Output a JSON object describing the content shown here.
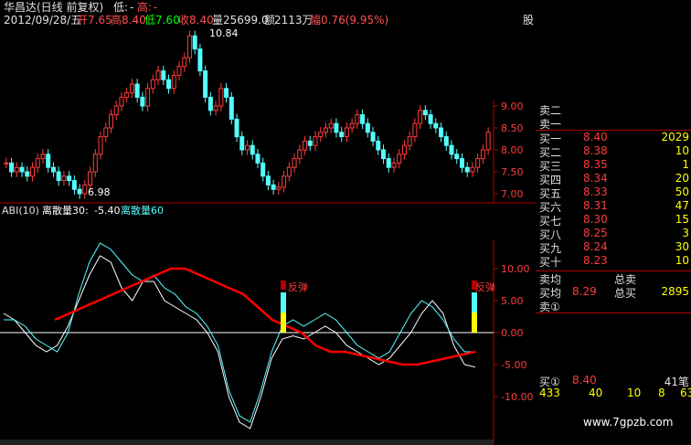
{
  "header": {
    "stock": "华昌达(日线 前复权)",
    "low_label": "低:",
    "low_value": "-",
    "high_label": "高:",
    "high_value": "-",
    "date": "2012/09/28/五",
    "open_label": "开",
    "open_value": "7.65",
    "high2_label": "高",
    "high2_value": "8.40",
    "low2_label": "低",
    "low2_value": "7.60",
    "close_label": "收",
    "close_value": "8.40",
    "vol_label": "量",
    "vol_value": "25699.0",
    "amt_label": "额",
    "amt_value": "2113万",
    "chg_label": "幅",
    "chg_value": "0.76(9.95%)",
    "cut": "股"
  },
  "indicator": {
    "name": "ABI(10)",
    "line1_label": "离散量30:",
    "line1_value": "-5.40",
    "line2_label": "离散量60",
    "signal_text": "反弹"
  },
  "watermark": "www.7gpzb.com",
  "colors": {
    "up": "#ff3c3c",
    "down": "#54ffff",
    "axis": "#b00000",
    "white": "#ffffff",
    "yellow": "#ffff00",
    "green": "#00ff00",
    "ma": "#ff0000"
  },
  "chart_data": [
    {
      "type": "candlestick",
      "title": "",
      "ylim": [
        6.8,
        10.9
      ],
      "y_ticks": [
        "9.00",
        "8.50",
        "8.00",
        "7.50",
        "7.00"
      ],
      "annotations": [
        "10.84",
        "6.98"
      ],
      "high": 10.84,
      "low": 6.98,
      "bar_count": 120
    },
    {
      "type": "line",
      "title": "ABI(10)",
      "ylim": [
        -12,
        12
      ],
      "y_ticks": [
        "10.00",
        "5.00",
        "0.00",
        "-5.00",
        "-10.00"
      ],
      "series": [
        {
          "name": "离散量30",
          "color": "#ffffff",
          "values": [
            3,
            2,
            0,
            -2,
            -3,
            -2,
            1,
            5,
            9,
            12,
            11,
            7,
            5,
            8,
            8,
            5,
            4,
            3,
            2,
            0,
            -3,
            -10,
            -14,
            -15,
            -10,
            -4,
            -1,
            -0.5,
            -1,
            0,
            1,
            0,
            -2,
            -3,
            -4,
            -5,
            -4,
            -2,
            0,
            3,
            5,
            3,
            -2,
            -5,
            -5.4
          ]
        },
        {
          "name": "离散量60",
          "color": "#54ffff",
          "values": [
            2,
            2,
            1,
            -1,
            -2,
            -3,
            0,
            6,
            11,
            14,
            13,
            11,
            9,
            8,
            9,
            7,
            6,
            4,
            3,
            1,
            -2,
            -9,
            -13,
            -14,
            -9,
            -3,
            1,
            2,
            1,
            2,
            3,
            2,
            0,
            -2,
            -3,
            -4,
            -3,
            0,
            3,
            5,
            4,
            2,
            -1,
            -3,
            -3
          ]
        },
        {
          "name": "MA",
          "color": "#ff0000",
          "values": [
            2,
            3,
            4,
            5,
            6,
            7,
            8,
            9,
            10,
            10,
            9,
            8,
            7,
            6,
            4,
            2,
            1,
            0,
            -2,
            -3,
            -3,
            -3.5,
            -4,
            -4.5,
            -5,
            -5,
            -4.5,
            -4,
            -3.5,
            -3
          ]
        }
      ],
      "signals": [
        "反弹",
        "反弹"
      ]
    }
  ],
  "order_book": {
    "sell": [
      {
        "label": "卖二",
        "price": "",
        "vol": ""
      },
      {
        "label": "卖一",
        "price": "",
        "vol": ""
      }
    ],
    "buy": [
      {
        "label": "买一",
        "price": "8.40",
        "vol": "2029"
      },
      {
        "label": "买二",
        "price": "8.38",
        "vol": "10"
      },
      {
        "label": "买三",
        "price": "8.35",
        "vol": "1"
      },
      {
        "label": "买四",
        "price": "8.34",
        "vol": "20"
      },
      {
        "label": "买五",
        "price": "8.33",
        "vol": "50"
      },
      {
        "label": "买六",
        "price": "8.31",
        "vol": "47"
      },
      {
        "label": "买七",
        "price": "8.30",
        "vol": "15"
      },
      {
        "label": "买八",
        "price": "8.25",
        "vol": "3"
      },
      {
        "label": "买九",
        "price": "8.24",
        "vol": "30"
      },
      {
        "label": "买十",
        "price": "8.23",
        "vol": "10"
      }
    ],
    "summary": [
      {
        "left": "卖均",
        "price": "",
        "mid": "总卖",
        "val": ""
      },
      {
        "left": "买均",
        "price": "8.29",
        "mid": "总买",
        "val": "2895"
      }
    ],
    "sell_marker": "卖①",
    "buy_marker": "买①",
    "buy_marker_price": "8.40",
    "buy_marker_count": "41笔",
    "bottom_row": [
      "433",
      "40",
      "10",
      "8",
      "63"
    ]
  }
}
